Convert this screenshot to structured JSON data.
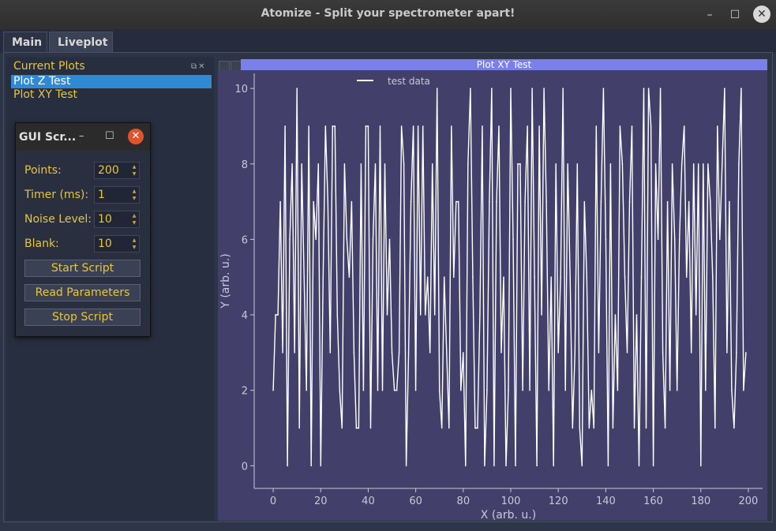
{
  "window": {
    "title": "Atomize - Split your spectrometer apart!",
    "minimize": "–",
    "maximize": "☐",
    "close": "✕"
  },
  "tabs": [
    {
      "label": "Main"
    },
    {
      "label": "Liveplot"
    }
  ],
  "current_plots": {
    "title": "Current Plots",
    "items": [
      "Plot Z Test",
      "Plot XY Test"
    ]
  },
  "dialog": {
    "title": "GUI Scr...",
    "fields": [
      {
        "label": "Points:",
        "value": "200"
      },
      {
        "label": "Timer (ms):",
        "value": "1"
      },
      {
        "label": "Noise Level:",
        "value": "10"
      },
      {
        "label": "Blank:",
        "value": "10"
      }
    ],
    "buttons": [
      "Start Script",
      "Read Parameters",
      "Stop Script"
    ]
  },
  "plot": {
    "header": "Plot XY Test"
  },
  "colors": {
    "plot_bg": "#42406a",
    "line": "#ffffff",
    "axis": "#c8c8d8",
    "header": "#7b7fe8",
    "accent": "#e6c63b"
  },
  "chart_data": {
    "type": "line",
    "xlabel": "X (arb. u.)",
    "ylabel": "Y (arb. u.)",
    "xlim": [
      -8,
      206
    ],
    "ylim": [
      -0.6,
      10.4
    ],
    "xticks": [
      0,
      20,
      40,
      60,
      80,
      100,
      120,
      140,
      160,
      180,
      200
    ],
    "yticks": [
      0,
      2,
      4,
      6,
      8,
      10
    ],
    "legend": "top-left",
    "series": [
      {
        "name": "test data",
        "x": [
          0,
          1,
          2,
          3,
          4,
          5,
          6,
          7,
          8,
          9,
          10,
          11,
          12,
          13,
          14,
          15,
          16,
          17,
          18,
          19,
          20,
          21,
          22,
          23,
          24,
          25,
          26,
          27,
          28,
          29,
          30,
          31,
          32,
          33,
          34,
          35,
          36,
          37,
          38,
          39,
          40,
          41,
          42,
          43,
          44,
          45,
          46,
          47,
          48,
          49,
          50,
          51,
          52,
          53,
          54,
          55,
          56,
          57,
          58,
          59,
          60,
          61,
          62,
          63,
          64,
          65,
          66,
          67,
          68,
          69,
          70,
          71,
          72,
          73,
          74,
          75,
          76,
          77,
          78,
          79,
          80,
          81,
          82,
          83,
          84,
          85,
          86,
          87,
          88,
          89,
          90,
          91,
          92,
          93,
          94,
          95,
          96,
          97,
          98,
          99,
          100,
          101,
          102,
          103,
          104,
          105,
          106,
          107,
          108,
          109,
          110,
          111,
          112,
          113,
          114,
          115,
          116,
          117,
          118,
          119,
          120,
          121,
          122,
          123,
          124,
          125,
          126,
          127,
          128,
          129,
          130,
          131,
          132,
          133,
          134,
          135,
          136,
          137,
          138,
          139,
          140,
          141,
          142,
          143,
          144,
          145,
          146,
          147,
          148,
          149,
          150,
          151,
          152,
          153,
          154,
          155,
          156,
          157,
          158,
          159,
          160,
          161,
          162,
          163,
          164,
          165,
          166,
          167,
          168,
          169,
          170,
          171,
          172,
          173,
          174,
          175,
          176,
          177,
          178,
          179,
          180,
          181,
          182,
          183,
          184,
          185,
          186,
          187,
          188,
          189,
          190,
          191,
          192,
          193,
          194,
          195,
          196,
          197,
          198,
          199
        ],
        "y": [
          2,
          4,
          4,
          7,
          3,
          9,
          0,
          6,
          8,
          3,
          10,
          1,
          8,
          5,
          2,
          9,
          0,
          7,
          6,
          8,
          0,
          5,
          9,
          7,
          3,
          9,
          9,
          4,
          2,
          1,
          8,
          6,
          5,
          7,
          3,
          1,
          1,
          8,
          2,
          9,
          9,
          1,
          6,
          8,
          2,
          9,
          2,
          8,
          4,
          6,
          3,
          2,
          2,
          3,
          9,
          8,
          0,
          3,
          7,
          9,
          2,
          9,
          4,
          9,
          4,
          5,
          3,
          8,
          4,
          10,
          2,
          1,
          5,
          3,
          1,
          9,
          5,
          7,
          7,
          2,
          3,
          0,
          8,
          10,
          5,
          1,
          1,
          4,
          9,
          0,
          2,
          7,
          10,
          0,
          7,
          9,
          3,
          5,
          0,
          2,
          10,
          6,
          0,
          8,
          8,
          2,
          7,
          9,
          2,
          10,
          5,
          0,
          9,
          4,
          10,
          7,
          2,
          5,
          0,
          8,
          3,
          5,
          10,
          2,
          8,
          5,
          1,
          3,
          8,
          1,
          0,
          7,
          5,
          1,
          2,
          1,
          9,
          3,
          7,
          10,
          6,
          0,
          8,
          1,
          4,
          2,
          9,
          8,
          5,
          3,
          7,
          9,
          1,
          4,
          0,
          5,
          10,
          1,
          10,
          9,
          0,
          8,
          6,
          10,
          3,
          1,
          7,
          2,
          8,
          6,
          2,
          6,
          8,
          9,
          5,
          7,
          3,
          8,
          4,
          8,
          0,
          8,
          2,
          8,
          7,
          5,
          1,
          9,
          6,
          8,
          10,
          3,
          7,
          2,
          1,
          3,
          8,
          10,
          2,
          3
        ]
      }
    ]
  }
}
